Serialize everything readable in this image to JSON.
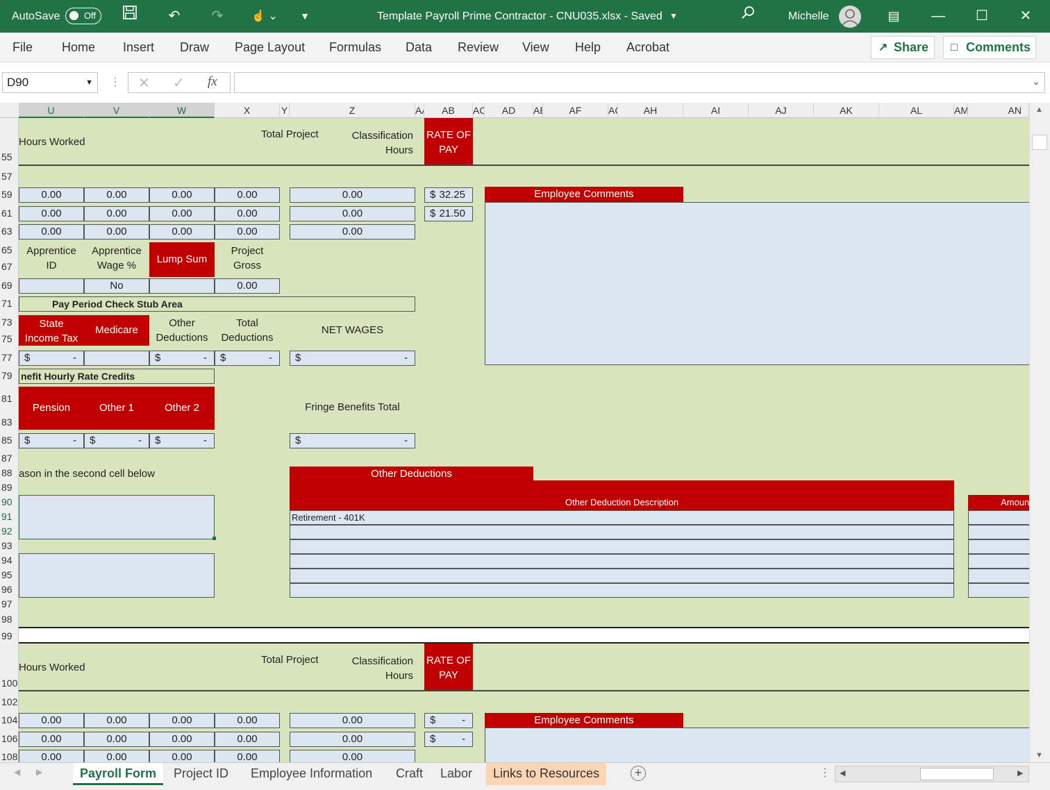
{
  "title_bar": {
    "autosave_label": "AutoSave",
    "toggle_state": "Off",
    "doc_title": "Template Payroll Prime Contractor - CNU035.xlsx  -  Saved",
    "user": "Michelle"
  },
  "ribbon": {
    "tabs": [
      "File",
      "Home",
      "Insert",
      "Draw",
      "Page Layout",
      "Formulas",
      "Data",
      "Review",
      "View",
      "Help",
      "Acrobat"
    ],
    "share": "Share",
    "comments": "Comments"
  },
  "formula_bar": {
    "name_box": "D90",
    "formula": "",
    "fx": "fx"
  },
  "columns": [
    "U",
    "V",
    "W",
    "X",
    "Y",
    "Z",
    "AA",
    "AB",
    "AC",
    "AD",
    "AE",
    "AF",
    "AG",
    "AH",
    "AI",
    "AJ",
    "AK",
    "AL",
    "AM",
    "AN"
  ],
  "rows": [
    "55",
    "57",
    "59",
    "61",
    "63",
    "65",
    "67",
    "69",
    "71",
    "73",
    "75",
    "77",
    "79",
    "81",
    "83",
    "85",
    "87",
    "88",
    "89",
    "90",
    "91",
    "92",
    "93",
    "94",
    "95",
    "96",
    "97",
    "98",
    "99",
    "100",
    "102",
    "104",
    "106",
    "108"
  ],
  "block1": {
    "hours_worked": "Hours Worked",
    "total_project": "Total Project",
    "classification_hours": "Classification\nHours",
    "rate_of_pay": "RATE OF\nPAY",
    "hours_rows": [
      [
        "0.00",
        "0.00",
        "0.00",
        "0.00",
        "0.00"
      ],
      [
        "0.00",
        "0.00",
        "0.00",
        "0.00",
        "0.00"
      ],
      [
        "0.00",
        "0.00",
        "0.00",
        "0.00",
        "0.00"
      ]
    ],
    "rates": [
      {
        "sym": "$",
        "val": "32.25"
      },
      {
        "sym": "$",
        "val": "21.50"
      }
    ],
    "employee_comments": "Employee Comments",
    "apprentice_id": "Apprentice\nID",
    "apprentice_wage": "Apprentice\nWage %",
    "lump_sum": "Lump Sum",
    "project_gross": "Project\nGross",
    "apprentice_wage_val": "No",
    "project_gross_val": "0.00",
    "check_stub": "Pay Period Check Stub Area",
    "state_income_tax": "State\nIncome Tax",
    "medicare": "Medicare",
    "other_deductions": "Other\nDeductions",
    "total_deductions": "Total\nDeductions",
    "net_wages": "NET WAGES",
    "dollar": "$",
    "dash": "-",
    "fringe_header": "nefit Hourly Rate Credits",
    "pension": "Pension",
    "other1": "Other 1",
    "other2": "Other 2",
    "fringe_total": "Fringe Benefits  Total",
    "reason": "ason in the second cell below",
    "other_deductions_title": "Other Deductions",
    "other_deduction_desc": "Other Deduction Description",
    "amount": "Amoun",
    "deduction_rows": [
      "Retirement - 401K",
      "",
      "",
      "",
      "",
      ""
    ]
  },
  "block2": {
    "hours_worked": "Hours Worked",
    "total_project": "Total Project",
    "classification_hours": "Classification\nHours",
    "rate_of_pay": "RATE OF\nPAY",
    "hours_rows": [
      [
        "0.00",
        "0.00",
        "0.00",
        "0.00",
        "0.00"
      ],
      [
        "0.00",
        "0.00",
        "0.00",
        "0.00",
        "0.00"
      ],
      [
        "0.00",
        "0.00",
        "0.00",
        "0.00",
        "0.00"
      ]
    ],
    "rates": [
      {
        "sym": "$",
        "val": "-"
      },
      {
        "sym": "$",
        "val": "-"
      }
    ],
    "employee_comments": "Employee Comments"
  },
  "sheet_tabs": [
    "Payroll Form",
    "Project ID",
    "Employee Information",
    "Craft",
    "Labor",
    "Links to Resources"
  ],
  "colors": {
    "excel_green": "#217346",
    "sheet_bg": "#d8e4bc",
    "input_bg": "#dce6f1",
    "red": "#c00000"
  }
}
